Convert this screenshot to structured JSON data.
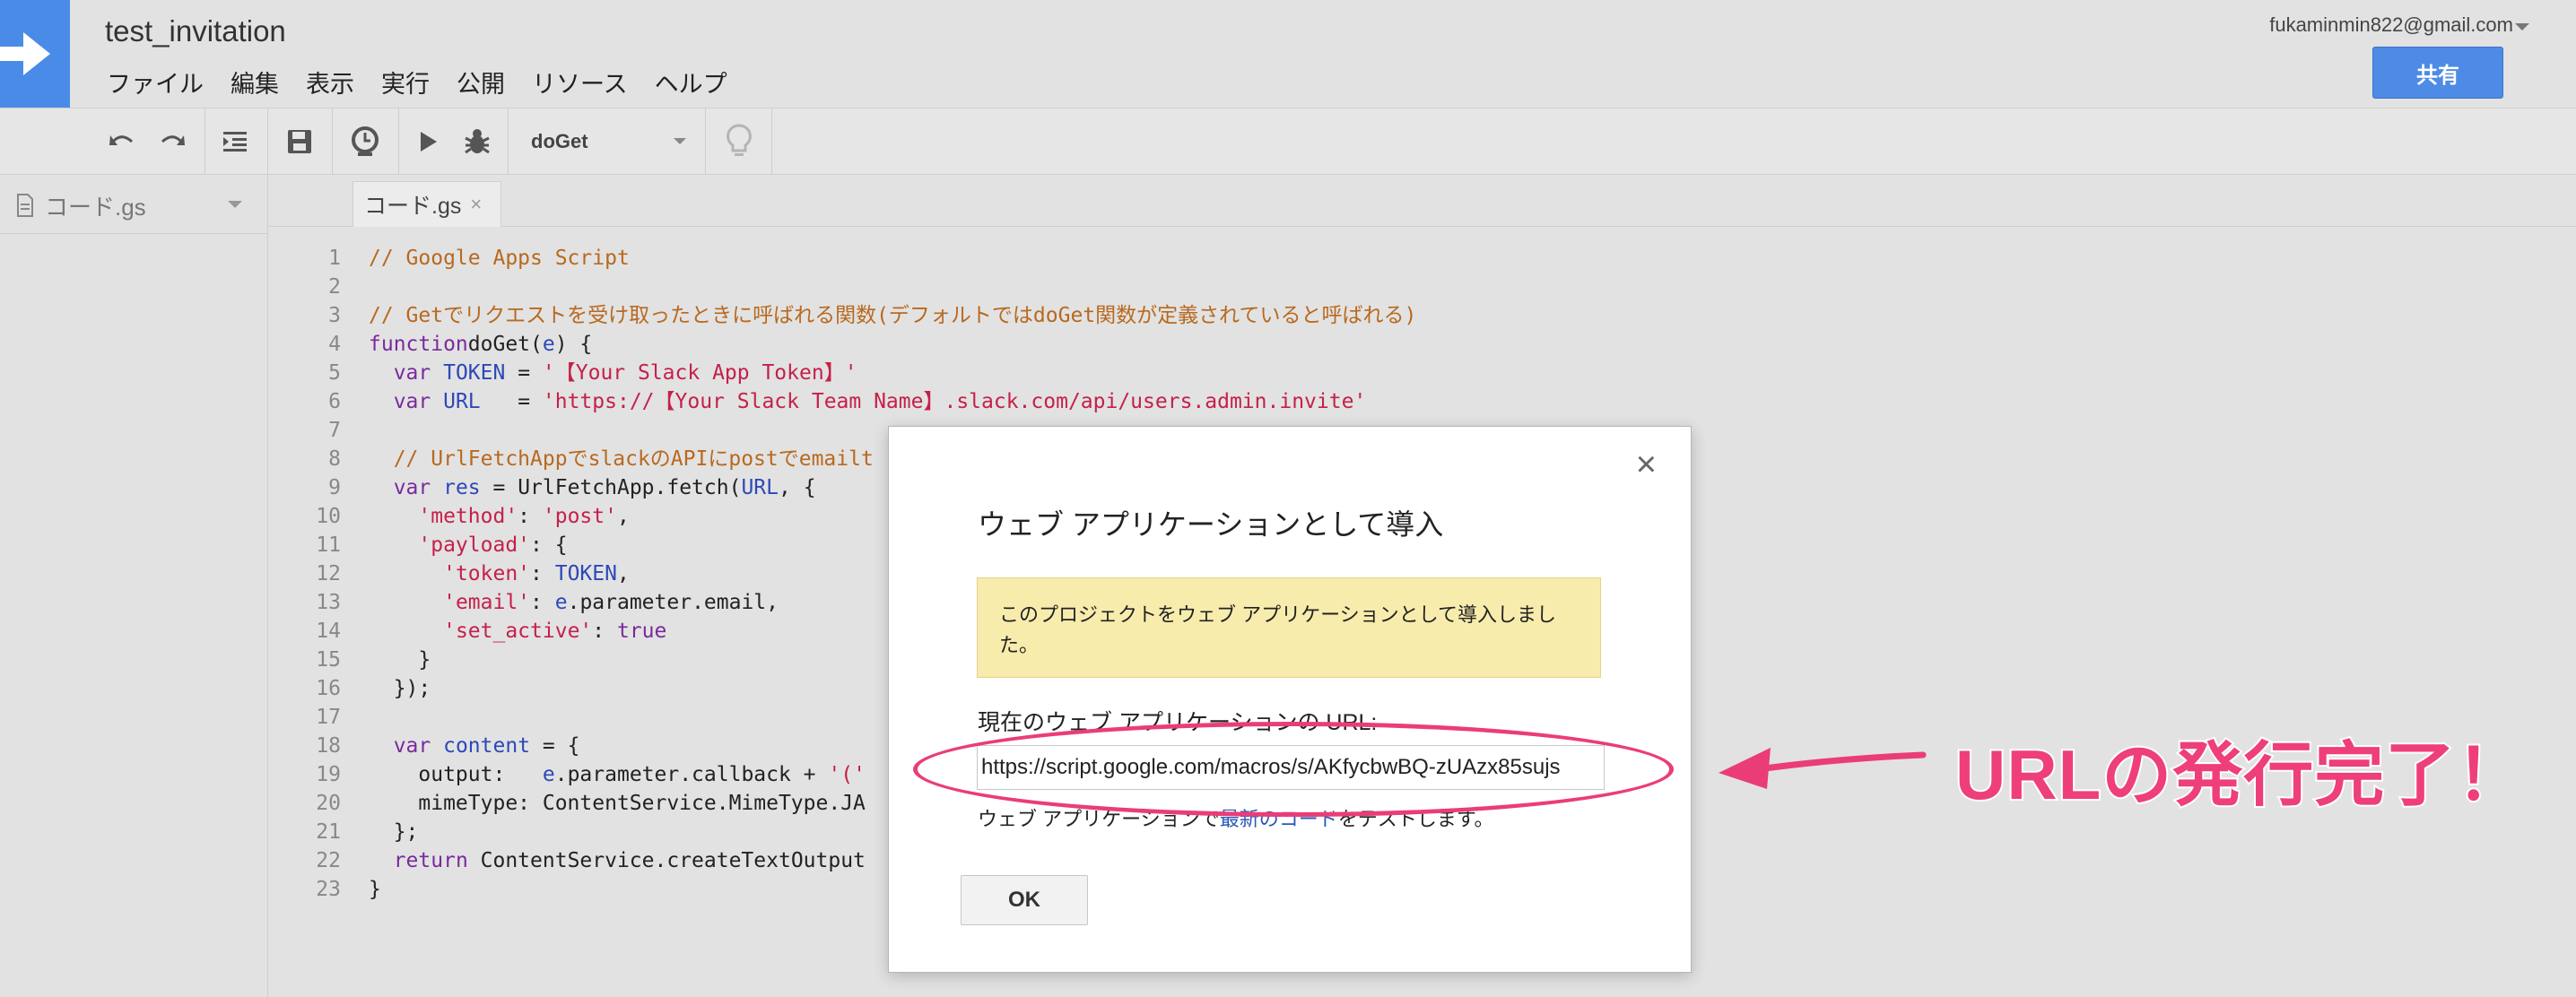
{
  "header": {
    "doc_title": "test_invitation",
    "menu": [
      "ファイル",
      "編集",
      "表示",
      "実行",
      "公開",
      "リソース",
      "ヘルプ"
    ],
    "account_email": "fukaminmin822@gmail.com",
    "share_label": "共有"
  },
  "toolbar": {
    "icons": [
      "undo-icon",
      "redo-icon",
      "indent-icon",
      "save-icon",
      "trigger-clock-icon",
      "run-icon",
      "debug-bug-icon",
      "lightbulb-icon"
    ],
    "function_select": "doGet"
  },
  "files": {
    "items": [
      {
        "label": "コード.gs"
      }
    ]
  },
  "editor": {
    "tab_label": "コード.gs",
    "tab_close": "×",
    "line_numbers": [
      "1",
      "2",
      "3",
      "4",
      "5",
      "6",
      "7",
      "8",
      "9",
      "10",
      "11",
      "12",
      "13",
      "14",
      "15",
      "16",
      "17",
      "18",
      "19",
      "20",
      "21",
      "22",
      "23"
    ]
  },
  "dialog": {
    "close": "×",
    "title": "ウェブ アプリケーションとして導入",
    "notice": "このプロジェクトをウェブ アプリケーションとして導入しました。",
    "url_label": "現在のウェブ アプリケーションの URL:",
    "url_value": "https://script.google.com/macros/s/AKfycbwBQ-zUAzx85sujs",
    "test_prefix": "ウェブ アプリケーションで",
    "test_link": "最新のコード",
    "test_suffix": "をテストします。",
    "ok_label": "OK"
  },
  "annotation": {
    "text": "URLの発行完了！",
    "color": "#ee3f7a"
  },
  "colors": {
    "accent_blue": "#4b8be8",
    "notice_bg": "#f8ecad",
    "comment": "#b8691f",
    "keyword": "#7a2a9e",
    "string": "#c5204a"
  }
}
